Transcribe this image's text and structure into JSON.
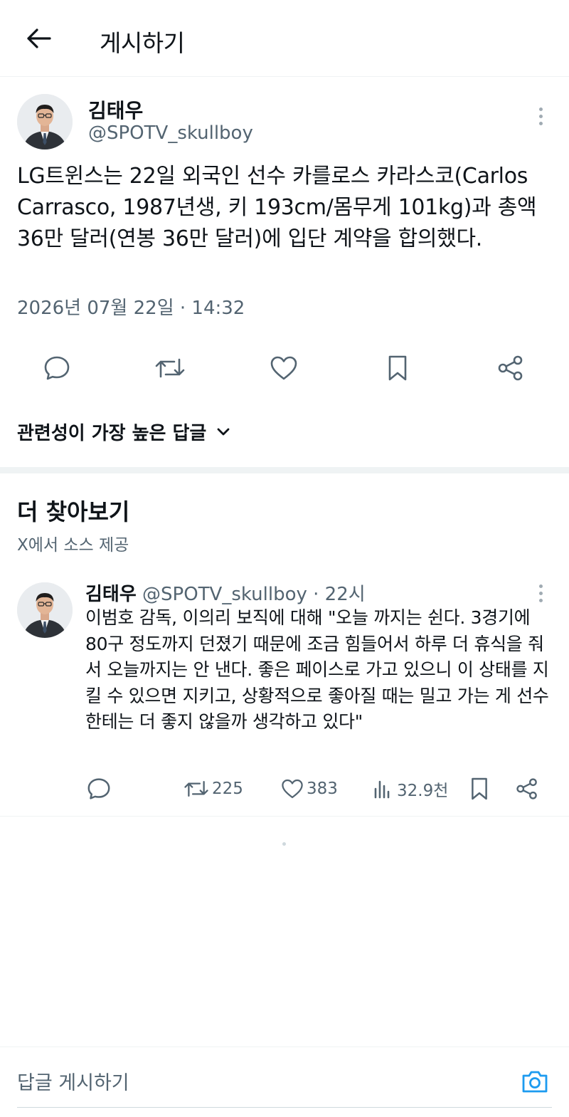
{
  "topbar": {
    "title": "게시하기",
    "back_icon": "arrow-left-icon"
  },
  "post": {
    "author_name": "김태우",
    "author_handle": "@SPOTV_skullboy",
    "text": "LG트윈스는 22일 외국인 선수 카를로스 카라스코(Carlos Carrasco, 1987년생, 키 193cm/몸무게 101kg)과 총액 36만 달러(연봉 36만 달러)에 입단 계약을 합의했다.",
    "timestamp": "2026년 07월 22일 · 14:32",
    "actions": [
      "reply-icon",
      "repost-icon",
      "like-icon",
      "bookmark-icon",
      "share-icon"
    ]
  },
  "replies_sort": {
    "label": "관련성이 가장 높은 답글"
  },
  "discover": {
    "title": "더 찾아보기",
    "subtitle": "X에서 소스 제공",
    "item": {
      "author_name": "김태우",
      "author_handle": "@SPOTV_skullboy",
      "dot": "·",
      "time": "22시",
      "text": "이범호 감독, 이의리 보직에 대해 \"오늘 까지는 쉰다. 3경기에 80구 정도까지 던졌기 때문에 조금 힘들어서 하루 더 휴식을 줘서 오늘까지는 안 낸다. 좋은 페이스로 가고 있으니 이 상태를 지킬 수 있으면 지키고, 상황적으로 좋아질 때는 밀고 가는 게 선수한테는 더 좋지 않을까 생각하고 있다\"",
      "reposts": "225",
      "likes": "383",
      "views": "32.9천"
    }
  },
  "reply_bar": {
    "placeholder": "답글 게시하기",
    "camera_icon": "camera-icon"
  },
  "colors": {
    "text": "#0f1419",
    "secondary": "#536471",
    "accent": "#1d9bf0",
    "border": "#eff3f4"
  }
}
